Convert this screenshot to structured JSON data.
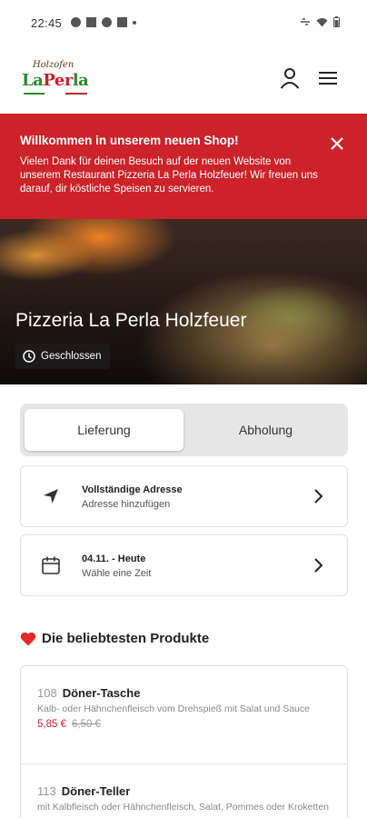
{
  "status_bar": {
    "time": "22:45"
  },
  "header": {
    "logo_top": "Holzofen",
    "logo_main": "LaPerla",
    "icons": {
      "user": "user-icon",
      "menu": "hamburger-menu-icon"
    }
  },
  "banner": {
    "title": "Willkommen in unserem neuen Shop!",
    "text": "Vielen Dank für deinen Besuch auf der neuen Website von unserem Restaurant Pizzeria La Perla Holzfeuer! Wir freuen uns darauf, dir köstliche Speisen zu servieren.",
    "background": "#cc2229"
  },
  "hero": {
    "title": "Pizzeria La Perla Holzfeuer",
    "status": "Geschlossen"
  },
  "order_mode": {
    "options": [
      "Lieferung",
      "Abholung"
    ],
    "selected": "Lieferung"
  },
  "address": {
    "title": "Vollständige Adresse",
    "subtitle": "Adresse hinzufügen"
  },
  "time": {
    "title": "04.11. - Heute",
    "subtitle": "Wähle eine Zeit"
  },
  "popular": {
    "title": "Die beliebtesten Produkte",
    "products": [
      {
        "number": "108",
        "name": "Döner-Tasche",
        "description": "Kalb- oder Hähnchenfleisch vom Drehspieß mit Salat und Sauce",
        "price": "5,85 €",
        "old_price": "6,50 €"
      },
      {
        "number": "113",
        "name": "Döner-Teller",
        "description": "mit Kalbfleisch oder Hähnchenfleisch, Salat, Pommes oder Kroketten"
      }
    ]
  },
  "colors": {
    "accent": "#cc2229",
    "logo_green": "#2f8a2f"
  }
}
